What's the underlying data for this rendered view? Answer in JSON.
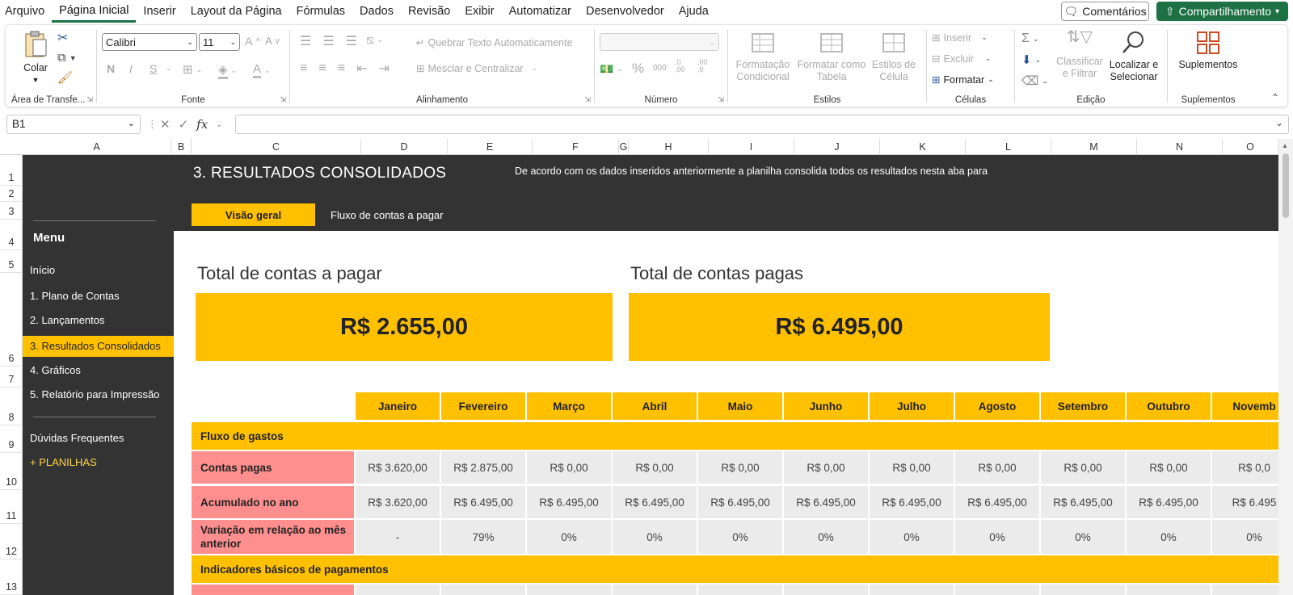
{
  "menubar": {
    "tabs": [
      "Arquivo",
      "Página Inicial",
      "Inserir",
      "Layout da Página",
      "Fórmulas",
      "Dados",
      "Revisão",
      "Exibir",
      "Automatizar",
      "Desenvolvedor",
      "Ajuda"
    ],
    "active_tab": "Página Inicial",
    "comments_label": "Comentários",
    "share_label": "Compartilhamento"
  },
  "ribbon": {
    "clipboard": {
      "paste_label": "Colar",
      "group_label": "Área de Transfe..."
    },
    "font": {
      "font_name": "Calibri",
      "font_size": "11",
      "bold": "N",
      "italic": "I",
      "underline": "S",
      "group_label": "Fonte"
    },
    "alignment": {
      "wrap_text": "Quebrar Texto Automaticamente",
      "merge_center": "Mesclar e Centralizar",
      "group_label": "Alinhamento"
    },
    "number": {
      "percent": "%",
      "thousands": "000",
      "dec_inc": ",0\n,00",
      "dec_dec": ",00\n,0",
      "group_label": "Número"
    },
    "styles": {
      "conditional": "Formatação Condicional",
      "as_table": "Formatar como Tabela",
      "cell_styles": "Estilos de Célula",
      "group_label": "Estilos"
    },
    "cells": {
      "insert": "Inserir",
      "delete": "Excluir",
      "format": "Formatar",
      "group_label": "Células"
    },
    "editing": {
      "sort_filter": "Classificar e Filtrar",
      "find_select": "Localizar e Selecionar",
      "group_label": "Edição"
    },
    "addins": {
      "label": "Suplementos",
      "group_label": "Suplementos"
    }
  },
  "formula_bar": {
    "name_box": "B1",
    "fx": "fx",
    "content": ""
  },
  "columns": [
    "A",
    "B",
    "C",
    "D",
    "E",
    "F",
    "G",
    "H",
    "I",
    "J",
    "K",
    "L",
    "M",
    "N",
    "O"
  ],
  "rows": [
    "1",
    "2",
    "3",
    "4",
    "5",
    "6",
    "7",
    "8",
    "9",
    "10",
    "11",
    "12",
    "13"
  ],
  "sheet": {
    "title": "3. RESULTADOS CONSOLIDADOS",
    "description": "De acordo com os dados inseridos anteriormente a planilha consolida todos os resultados nesta aba para",
    "tabs": [
      "Visão geral",
      "Fluxo de contas a pagar"
    ],
    "menu_title": "Menu",
    "menu_items": [
      "Início",
      "1. Plano de Contas",
      "2. Lançamentos",
      "3. Resultados Consolidados",
      "4. Gráficos",
      "5. Relatório para Impressão"
    ],
    "active_menu_item": "3. Resultados Consolidados",
    "faq": "Dúvidas Frequentes",
    "more": "+ PLANILHAS",
    "kpi_payable_title": "Total de contas a pagar",
    "kpi_payable_value": "R$ 2.655,00",
    "kpi_paid_title": "Total de contas pagas",
    "kpi_paid_value": "R$ 6.495,00",
    "months": [
      "Janeiro",
      "Fevereiro",
      "Março",
      "Abril",
      "Maio",
      "Junho",
      "Julho",
      "Agosto",
      "Setembro",
      "Outubro",
      "Novemb"
    ],
    "section_flow": "Fluxo de gastos",
    "rows": [
      {
        "label": "Contas pagas",
        "values": [
          "R$ 3.620,00",
          "R$ 2.875,00",
          "R$ 0,00",
          "R$ 0,00",
          "R$ 0,00",
          "R$ 0,00",
          "R$ 0,00",
          "R$ 0,00",
          "R$ 0,00",
          "R$ 0,00",
          "R$ 0,0"
        ]
      },
      {
        "label": "Acumulado no ano",
        "values": [
          "R$ 3.620,00",
          "R$ 6.495,00",
          "R$ 6.495,00",
          "R$ 6.495,00",
          "R$ 6.495,00",
          "R$ 6.495,00",
          "R$ 6.495,00",
          "R$ 6.495,00",
          "R$ 6.495,00",
          "R$ 6.495,00",
          "R$ 6.495"
        ]
      },
      {
        "label": "Variação em relação ao mês anterior",
        "values": [
          "-",
          "79%",
          "0%",
          "0%",
          "0%",
          "0%",
          "0%",
          "0%",
          "0%",
          "0%",
          "0%"
        ]
      }
    ],
    "section_indicators": "Indicadores básicos de pagamentos"
  },
  "colors": {
    "dark": "#333333",
    "accent": "#ffc000",
    "label_red": "#ff8f8f",
    "value_gray": "#ebebeb",
    "excel_green": "#1e7145"
  }
}
